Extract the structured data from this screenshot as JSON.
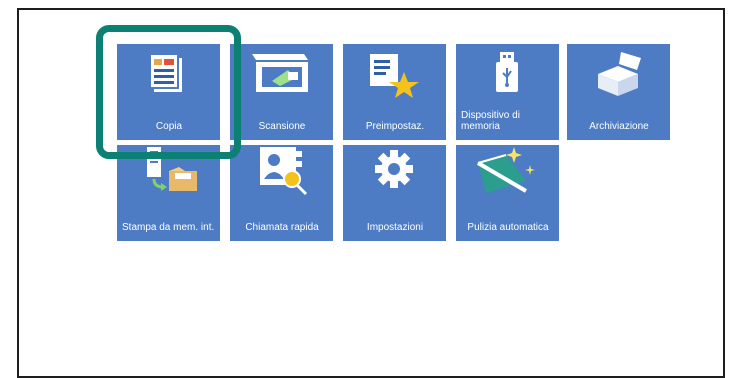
{
  "tiles": [
    {
      "id": "copy",
      "label": "Copia"
    },
    {
      "id": "scan",
      "label": "Scansione"
    },
    {
      "id": "presets",
      "label": "Preimpostaz."
    },
    {
      "id": "memory-device",
      "label": "Dispositivo di memoria"
    },
    {
      "id": "storage",
      "label": "Archiviazione"
    },
    {
      "id": "print-from-memory",
      "label": "Stampa da mem. int."
    },
    {
      "id": "speed-dial",
      "label": "Chiamata rapida"
    },
    {
      "id": "settings",
      "label": "Impostazioni"
    },
    {
      "id": "auto-clean",
      "label": "Pulizia automatica"
    }
  ],
  "icons": {
    "copy": "document-copy-icon",
    "scan": "scanner-icon",
    "presets": "preset-star-icon",
    "memory-device": "usb-drive-icon",
    "storage": "storage-box-icon",
    "print-from-memory": "print-from-memory-icon",
    "speed-dial": "contact-search-icon",
    "settings": "gear-icon",
    "auto-clean": "cleaning-icon"
  },
  "colors": {
    "tile": "#4d7cc4",
    "highlight": "#0b8073",
    "star": "#f5c21b",
    "accent_green": "#7fd35f"
  }
}
